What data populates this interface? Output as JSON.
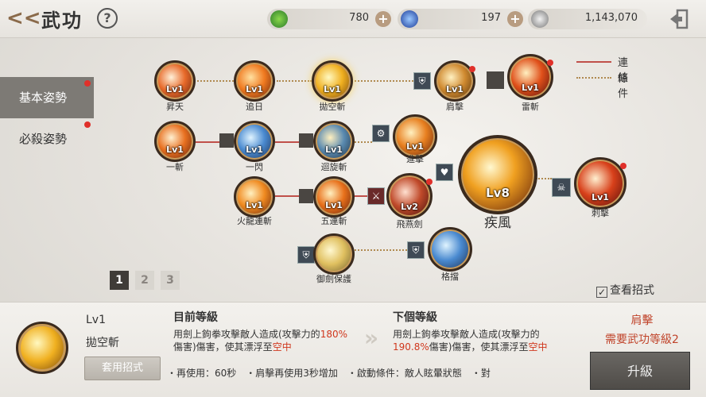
{
  "header": {
    "back_icon": "back-arrow-icon",
    "title": "武功",
    "help_label": "?"
  },
  "currencies": [
    {
      "icon": "green-coin-icon",
      "value": "780",
      "color": "#3a9a3a",
      "plus": "+"
    },
    {
      "icon": "blue-gem-icon",
      "value": "197",
      "color": "#2a4aa8",
      "plus": "+"
    },
    {
      "icon": "silver-coin-icon",
      "value": "1,143,070",
      "color": "#8f8f8f"
    }
  ],
  "sidebar": {
    "items": [
      {
        "label": "基本姿勢",
        "active": true
      },
      {
        "label": "必殺姿勢",
        "active": false
      }
    ]
  },
  "legend": {
    "link_label": "連結",
    "condition_label": "條件"
  },
  "skills": [
    {
      "name": "昇天",
      "lv": "Lv1"
    },
    {
      "name": "追日",
      "lv": "Lv1"
    },
    {
      "name": "拋空斬",
      "lv": "Lv1"
    },
    {
      "name": "肩擊",
      "lv": "Lv1"
    },
    {
      "name": "雷斬",
      "lv": "Lv1"
    },
    {
      "name": "一斬",
      "lv": "Lv1"
    },
    {
      "name": "一閃",
      "lv": "Lv1"
    },
    {
      "name": "迴旋斬",
      "lv": "Lv1"
    },
    {
      "name": "進擊",
      "lv": "Lv1"
    },
    {
      "name": "疾風",
      "lv": "Lv8"
    },
    {
      "name": "刺擊",
      "lv": "Lv1"
    },
    {
      "name": "火龍連斬",
      "lv": "Lv1"
    },
    {
      "name": "五連斬",
      "lv": "Lv1"
    },
    {
      "name": "飛燕劍",
      "lv": "Lv2"
    },
    {
      "name": "御劍保護",
      "lv": ""
    },
    {
      "name": "格擋",
      "lv": ""
    }
  ],
  "pager": {
    "pages": [
      "1",
      "2",
      "3"
    ],
    "current": "1"
  },
  "show_moves_label": "查看招式",
  "detail": {
    "lv": "Lv1",
    "name": "拋空斬",
    "apply_label": "套用招式",
    "current": {
      "header": "目前等級",
      "t1": "用劍上鉤拳攻擊敵人造成(攻擊力的",
      "h1": "180%",
      "t2": "傷害)傷害，使其漂浮至",
      "h2": "空中"
    },
    "next": {
      "header": "下個等級",
      "t1": "用劍上鉤拳攻擊敵人造成(攻擊力的",
      "h1": "190.8%",
      "t2": "傷害)傷害，使其漂浮至",
      "h2": "空中"
    },
    "effects": "・再使用：60秒　・肩擊再使用3秒增加　・啟動條件：敵人眩暈狀態　・對",
    "req_skill": "肩擊",
    "req_text": "需要武功等級2",
    "upgrade_label": "升級"
  }
}
